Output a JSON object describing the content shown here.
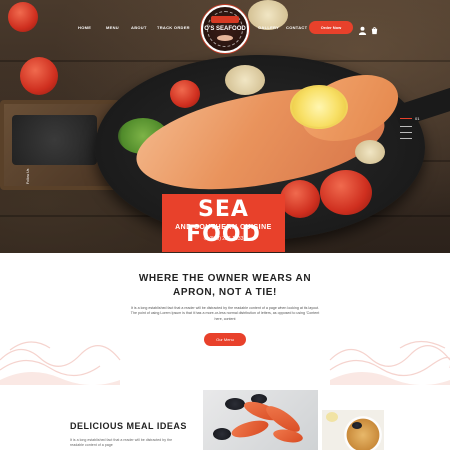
{
  "nav": {
    "items": [
      "HOME",
      "MENU",
      "ABOUT",
      "TRACK ORDER",
      "GALLERY",
      "CONTACT"
    ],
    "order_button": "Order Now",
    "icons": [
      "user-icon",
      "cart-icon"
    ]
  },
  "logo": {
    "text": "O'S SEAFOOD"
  },
  "hero": {
    "follow_label": "Follow Us",
    "slide_number": "01",
    "banner_title": "SEA FOOD",
    "banner_subtitle": "AND SOUTHERN CUISINE",
    "banner_phone": "(800) 222-1333"
  },
  "about": {
    "title_line1": "WHERE THE OWNER WEARS AN",
    "title_line2": "APRON, NOT A TIE!",
    "body": "It is a long established fact that a reader will be distracted by the readable content of a page when looking at its layout. The point of using Lorem Ipsum is that it has a more-or-less normal distribution of letters, as opposed to using 'Content here, content",
    "button": "Our Menu"
  },
  "meal": {
    "title": "DELICIOUS MEAL IDEAS",
    "body": "It is a long established fact that a reader will be distracted by the readable content of a page"
  },
  "colors": {
    "accent": "#e8412b",
    "dark_text": "#222222"
  }
}
